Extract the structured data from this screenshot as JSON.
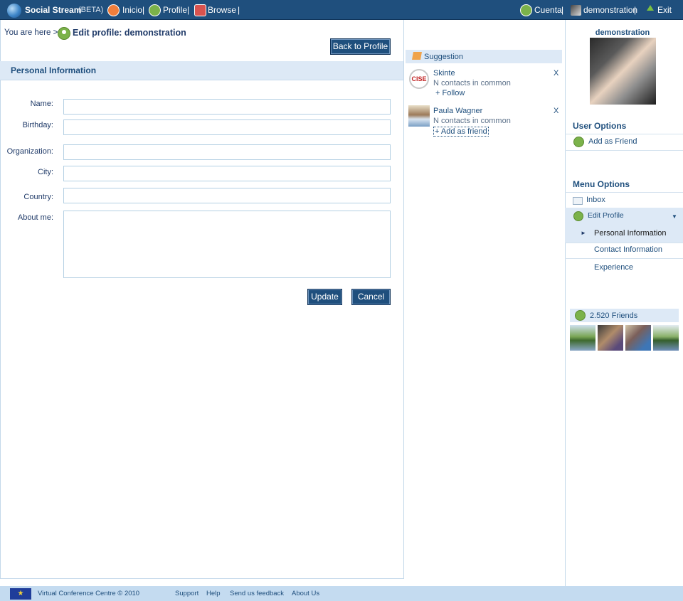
{
  "topbar": {
    "brand": "Social Stream",
    "beta": "(BETA)",
    "nav": [
      {
        "label": "Inicio",
        "icon": "home-icon"
      },
      {
        "label": "Profile",
        "icon": "profile-icon"
      },
      {
        "label": "Browse",
        "icon": "browse-icon"
      }
    ],
    "separator": "|",
    "account_label": "Cuenta",
    "user_label": "demonstration",
    "exit_label": "Exit"
  },
  "breadcrumb": {
    "prefix": "You are here >",
    "title": "Edit profile: demonstration"
  },
  "back_button": "Back to Profile",
  "form": {
    "section_title": "Personal Information",
    "fields": [
      {
        "label": "Name:",
        "value": ""
      },
      {
        "label": "Birthday:",
        "value": ""
      },
      {
        "label": "Organization:",
        "value": ""
      },
      {
        "label": "City:",
        "value": ""
      },
      {
        "label": "Country:",
        "value": ""
      },
      {
        "label": "About me:",
        "value": ""
      }
    ],
    "update_button": "Update",
    "cancel_button": "Cancel"
  },
  "suggestions": {
    "title": "Suggestion",
    "items": [
      {
        "name": "Skinte",
        "logo_text": "CISE",
        "common": "N contacts in common",
        "action": "+ Follow",
        "dismiss": "X"
      },
      {
        "name": "Paula Wagner",
        "common": "N contacts in common",
        "action": "+ Add as friend",
        "dismiss": "X"
      }
    ]
  },
  "sidebar": {
    "username": "demonstration",
    "user_options_title": "User Options",
    "add_friend": "Add as Friend",
    "menu_options_title": "Menu Options",
    "menu": [
      {
        "label": "Inbox"
      },
      {
        "label": "Edit Profile",
        "expander": "▼"
      },
      {
        "label": "Personal Information",
        "marker": "►"
      },
      {
        "label": "Contact Information"
      },
      {
        "label": "Experience"
      }
    ],
    "friends_label": "2.520 Friends"
  },
  "footer": {
    "copyright": "Virtual Conference Centre © 2010",
    "links": [
      "Support",
      "Help",
      "Send us feedback",
      "About Us"
    ]
  },
  "colors": {
    "topbar": "#1f4f7d",
    "accent_light": "#dde9f6",
    "text": "#1f3a68",
    "icon_green": "#7bb24a"
  }
}
